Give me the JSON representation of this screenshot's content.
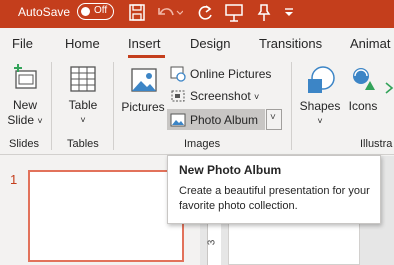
{
  "titlebar": {
    "autosave_label": "AutoSave",
    "toggle_state": "Off",
    "bg_color": "#c43e1c",
    "qat_icons": [
      "save-icon",
      "undo-icon",
      "redo-icon",
      "present-icon",
      "pin-icon",
      "customize-chevron-icon"
    ]
  },
  "tabs": {
    "items": [
      "File",
      "Home",
      "Insert",
      "Design",
      "Transitions",
      "Animat"
    ],
    "active": "Insert"
  },
  "ribbon": {
    "slides_group": {
      "new_slide_line1": "New",
      "new_slide_line2": "Slide",
      "label": "Slides"
    },
    "tables_group": {
      "table": "Table",
      "label": "Tables"
    },
    "images_group": {
      "pictures": "Pictures",
      "online_pictures": "Online Pictures",
      "screenshot": "Screenshot",
      "photo_album": "Photo Album",
      "label": "Images"
    },
    "illustrations_group": {
      "shapes": "Shapes",
      "icons": "Icons",
      "label": "Illustra"
    }
  },
  "thumbnails": {
    "slide_number": "1"
  },
  "ruler": {
    "mark": "3"
  },
  "tooltip": {
    "title": "New Photo Album",
    "body": "Create a beautiful presentation for your favorite photo collection."
  }
}
